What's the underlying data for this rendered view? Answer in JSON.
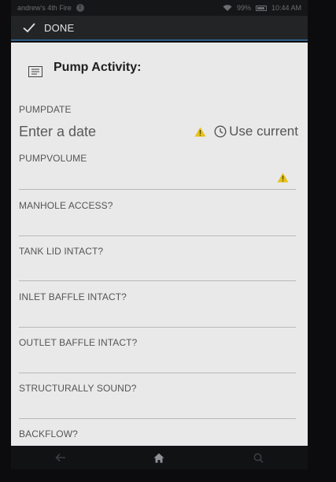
{
  "status_bar": {
    "device_name": "andrew's 4th Fire",
    "battery": "99%",
    "time": "10:44 AM"
  },
  "action_bar": {
    "done_label": "DONE"
  },
  "form": {
    "title": "Pump Activity:",
    "fields": [
      {
        "label": "PUMPDATE",
        "placeholder": "Enter a date",
        "use_current_label": "Use current"
      },
      {
        "label": "PUMPVOLUME"
      },
      {
        "label": "MANHOLE ACCESS?"
      },
      {
        "label": "TANK LID INTACT?"
      },
      {
        "label": "INLET BAFFLE INTACT?"
      },
      {
        "label": "OUTLET BAFFLE INTACT?"
      },
      {
        "label": "STRUCTURALLY SOUND?"
      },
      {
        "label": "BACKFLOW?"
      }
    ]
  },
  "colors": {
    "warning": "#e6c21a",
    "form_background": "#e9e9e9",
    "action_bar": "#222426"
  },
  "icons": {
    "done": "check-icon",
    "form": "list-icon",
    "warning": "warning-icon",
    "clock": "clock-icon",
    "back": "back-arrow-icon",
    "home": "home-icon",
    "search": "search-icon"
  }
}
